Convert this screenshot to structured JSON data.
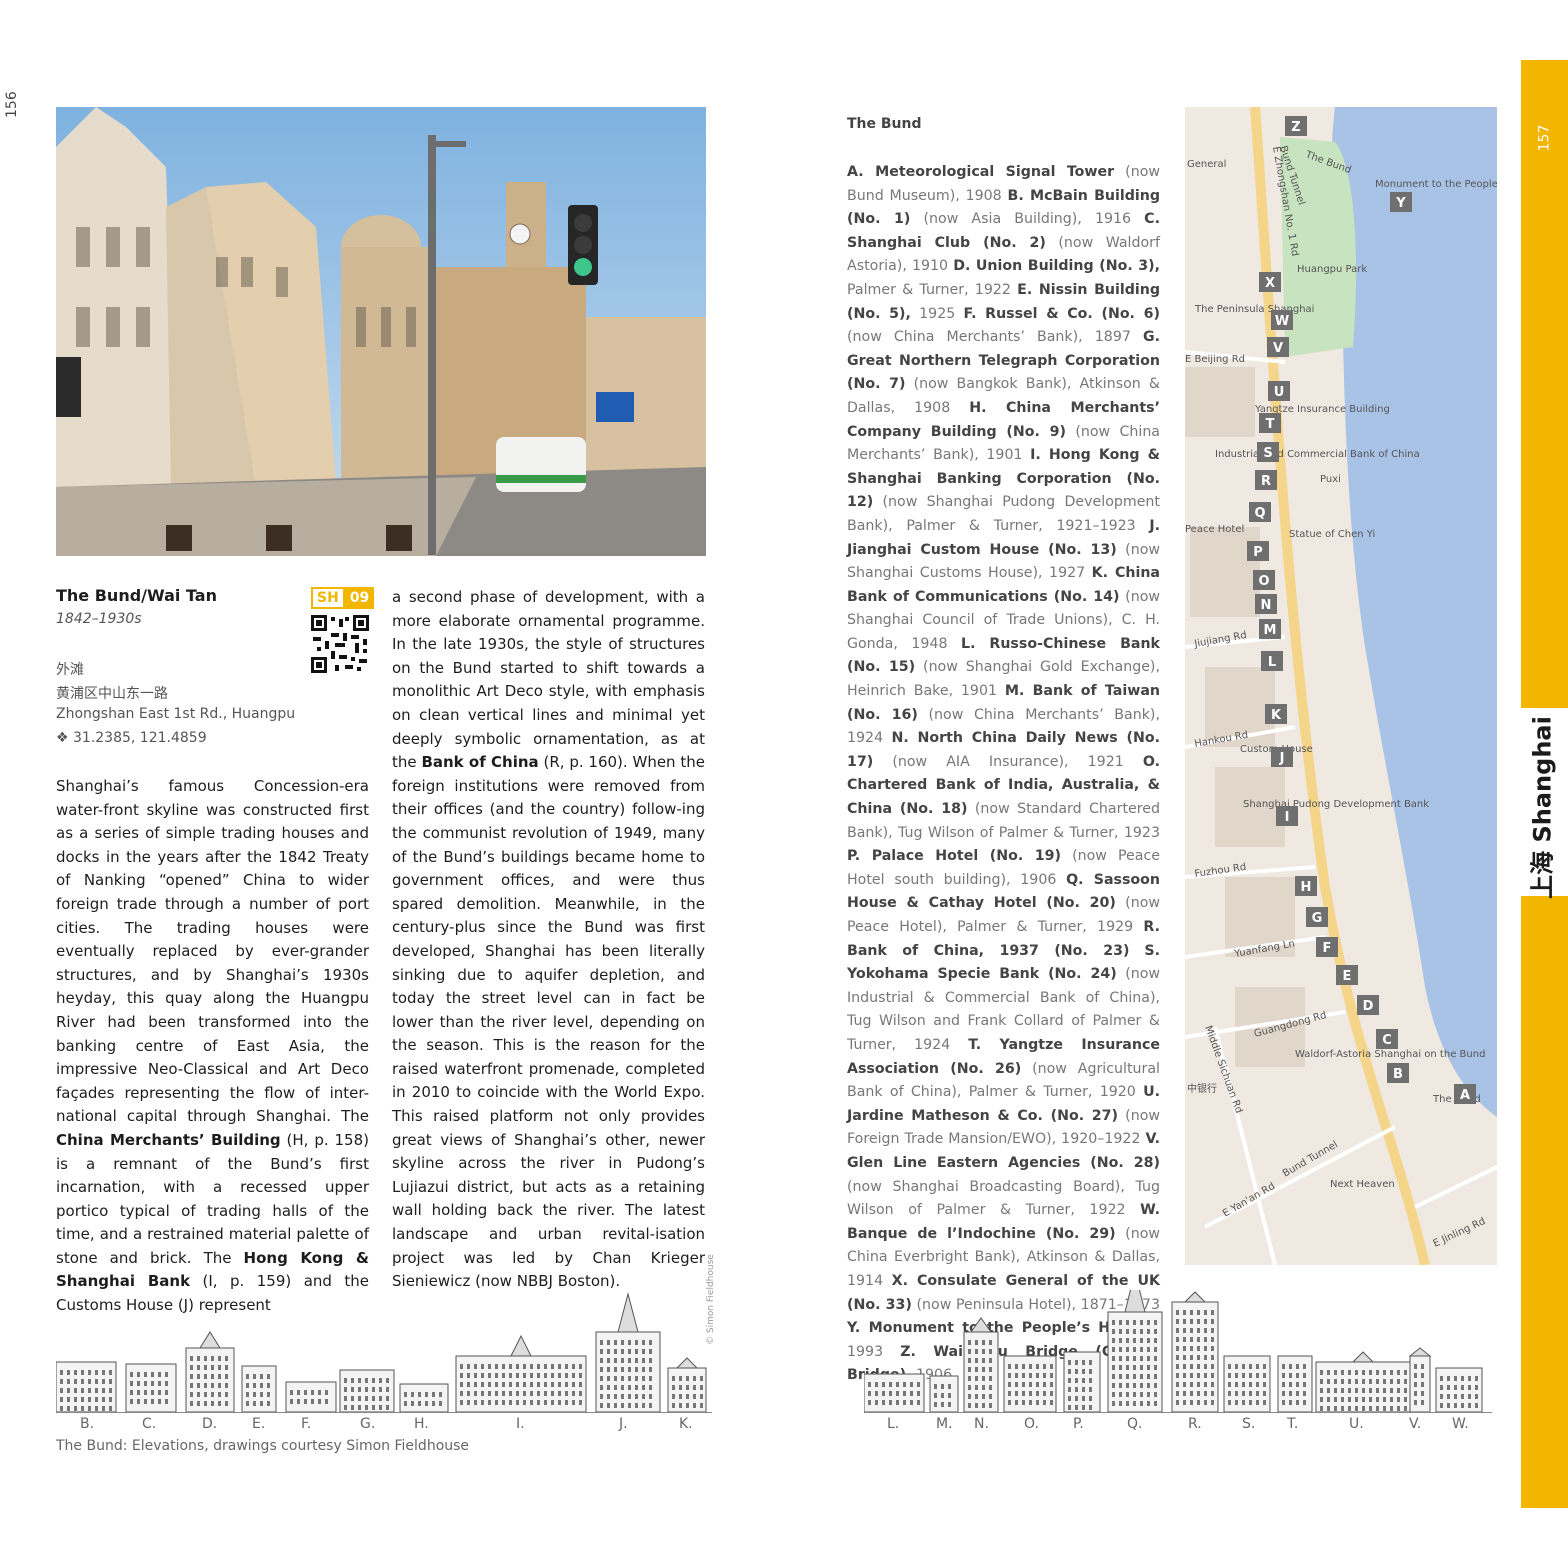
{
  "page_numbers": {
    "left": "156",
    "right": "157"
  },
  "side_tab": {
    "label": "上海 Shanghai"
  },
  "entry": {
    "title": "The Bund/Wai Tan",
    "dates": "1842–1930s",
    "badge_code": "SH",
    "badge_num": "09",
    "chinese_name": "外滩",
    "chinese_address": "黄浦区中山东一路",
    "address": "Zhongshan East 1st Rd., Huangpu",
    "coordinates": "❖ 31.2385, 121.4859"
  },
  "body": {
    "col1_a": "Shanghai’s famous Concession-era water-front skyline was constructed first as a series of simple trading houses and docks in the years after the 1842 Treaty of Nanking “opened” China to wider foreign trade through a number of port cities. The trading houses were eventually replaced by ever-grander structures, and by Shanghai’s 1930s heyday, this quay along the Huangpu River had been transformed into the banking centre of East Asia, the impressive Neo-Classical and Art Deco façades representing the flow of inter-national capital through Shanghai. The ",
    "col1_b_bold": "China Merchants’ Building",
    "col1_c": " (H, p. 158) is a remnant of the Bund’s first incarnation, with a recessed upper portico typical of trading halls of the time, and a restrained material palette of stone and brick. The ",
    "col1_d_bold": "Hong Kong & Shanghai Bank",
    "col1_e": " (I, p. 159) and the Customs House (J) represent",
    "col2_a": "a second phase of development, with a more elaborate ornamental programme. In the late 1930s, the style of structures on the Bund started to shift towards a monolithic Art Deco style, with emphasis on clean vertical lines and minimal yet deeply symbolic ornamentation, as at the ",
    "col2_b_bold": "Bank of China",
    "col2_c": " (R, p. 160). When the foreign institutions were removed from their offices (and the country) follow-ing the communist revolution of 1949, many of the Bund’s buildings became home to government offices, and were thus spared demolition. Meanwhile, in the century-plus since the Bund was first developed, Shanghai has been literally sinking due to aquifer depletion, and today the street level can in fact be lower than the river level, depending on the season. This is the reason for the raised waterfront promenade, completed in 2010 to coincide with the World Expo. This raised platform not only provides great views of Shanghai’s other, newer skyline across the river in Pudong’s Lujiazui district, but acts as a retaining wall holding back the river. The latest landscape and urban revital-isation project was led by Chan Krieger Sieniewicz (now NBBJ Boston)."
  },
  "bund_list": {
    "heading": "The Bund",
    "items": [
      {
        "name": "A. Meteorological Signal Tower",
        "rest": " (now Bund Museum), 1908 "
      },
      {
        "name": "B. McBain Building (No. 1)",
        "rest": " (now Asia Building), 1916 "
      },
      {
        "name": "C. Shanghai Club (No. 2)",
        "rest": " (now Waldorf Astoria), 1910 "
      },
      {
        "name": "D. Union Building (No. 3),",
        "rest": " Palmer & Turner, 1922 "
      },
      {
        "name": "E. Nissin Building (No. 5),",
        "rest": " 1925 "
      },
      {
        "name": "F. Russel & Co. (No. 6)",
        "rest": " (now China Merchants’ Bank), 1897 "
      },
      {
        "name": "G. Great Northern Telegraph Corporation (No. 7)",
        "rest": " (now Bangkok Bank), Atkinson & Dallas, 1908 "
      },
      {
        "name": "H. China Merchants’ Company Building (No. 9)",
        "rest": " (now China Merchants’ Bank), 1901 "
      },
      {
        "name": "I. Hong Kong & Shanghai Banking Corporation (No. 12)",
        "rest": " (now Shanghai Pudong Development Bank), Palmer & Turner, 1921–1923 "
      },
      {
        "name": "J. Jianghai Custom House (No. 13)",
        "rest": " (now Shanghai Customs House), 1927 "
      },
      {
        "name": "K. China Bank of Communications (No. 14)",
        "rest": " (now Shanghai Council of Trade Unions), C. H. Gonda, 1948 "
      },
      {
        "name": "L. Russo-Chinese Bank (No. 15)",
        "rest": " (now Shanghai Gold Exchange), Heinrich Bake, 1901 "
      },
      {
        "name": "M. Bank of Taiwan (No. 16)",
        "rest": " (now China Merchants’ Bank), 1924 "
      },
      {
        "name": "N. North China Daily News (No. 17)",
        "rest": " (now AIA Insurance), 1921 "
      },
      {
        "name": "O. Chartered Bank of India, Australia, & China (No. 18)",
        "rest": " (now Standard Chartered Bank), Tug Wilson of Palmer & Turner, 1923 "
      },
      {
        "name": "P. Palace Hotel (No. 19)",
        "rest": " (now Peace Hotel south building), 1906 "
      },
      {
        "name": "Q. Sassoon House & Cathay Hotel (No. 20)",
        "rest": " (now Peace Hotel), Palmer & Turner, 1929 "
      },
      {
        "name": "R. Bank of China, 1937 (No. 23)",
        "rest": " "
      },
      {
        "name": "S. Yokohama Specie Bank (No. 24)",
        "rest": " (now Industrial & Commercial Bank of China), Tug Wilson and Frank Collard of Palmer & Turner, 1924 "
      },
      {
        "name": "T. Yangtze Insurance Association (No. 26)",
        "rest": " (now Agricultural Bank of China), Palmer & Turner, 1920 "
      },
      {
        "name": "U. Jardine Matheson & Co. (No. 27)",
        "rest": " (now Foreign Trade Mansion/EWO), 1920–1922 "
      },
      {
        "name": "V. Glen Line Eastern Agencies (No. 28)",
        "rest": " (now Shanghai Broadcasting Board), Tug Wilson of Palmer & Turner, 1922 "
      },
      {
        "name": "W. Banque de l’Indochine (No. 29)",
        "rest": " (now China Everbright Bank), Atkinson & Dallas, 1914 "
      },
      {
        "name": "X. Consulate General of the UK (No. 33)",
        "rest": " (now Peninsula Hotel), 1871–1873 "
      },
      {
        "name": "Y. Monument to the People’s Heroes,",
        "rest": " 1993 "
      },
      {
        "name": "Z. Waibaidu Bridge (Garden Bridge),",
        "rest": " 1906"
      }
    ]
  },
  "map": {
    "streets": [
      "E Zhongshan No. 1 Rd",
      "Bund Tunnel",
      "E Beijing Rd",
      "Jiujiang Rd",
      "Hankou Rd",
      "Fuzhou Rd",
      "Yuanfang Ln",
      "Guangdong Rd",
      "Middle Sichuan Rd",
      "E Yan'an Rd",
      "E Jinling Rd",
      "The Bund",
      "Bund Tunnel"
    ],
    "places": [
      "Huangpu Park",
      "Monument to the People's Heroes",
      "The Peninsula Shanghai",
      "Industrial and Commercial Bank of China",
      "Puxi",
      "Statue of Chen Yi",
      "Peace Hotel",
      "Shanghai Pudong Development Bank",
      "Waldorf-Astoria Shanghai on the Bund",
      "The Bund",
      "Next Heaven",
      "Custom House",
      "中银行",
      "General",
      "Yangtze Insurance Building"
    ],
    "pins": [
      "Z",
      "Y",
      "X",
      "W",
      "V",
      "U",
      "T",
      "S",
      "R",
      "Q",
      "P",
      "O",
      "N",
      "M",
      "L",
      "K",
      "J",
      "I",
      "H",
      "G",
      "F",
      "E",
      "D",
      "C",
      "B",
      "A"
    ]
  },
  "elevations": {
    "left_labels": [
      "B.",
      "C.",
      "D.",
      "E.",
      "F.",
      "G.",
      "H.",
      "I.",
      "J.",
      "K."
    ],
    "right_labels": [
      "L.",
      "M.",
      "N.",
      "O.",
      "P.",
      "Q.",
      "R.",
      "S.",
      "T.",
      "U.",
      "V.",
      "W."
    ],
    "caption": "The Bund: Elevations, drawings courtesy Simon Fieldhouse",
    "credit": "© Simon Fieldhouse"
  }
}
